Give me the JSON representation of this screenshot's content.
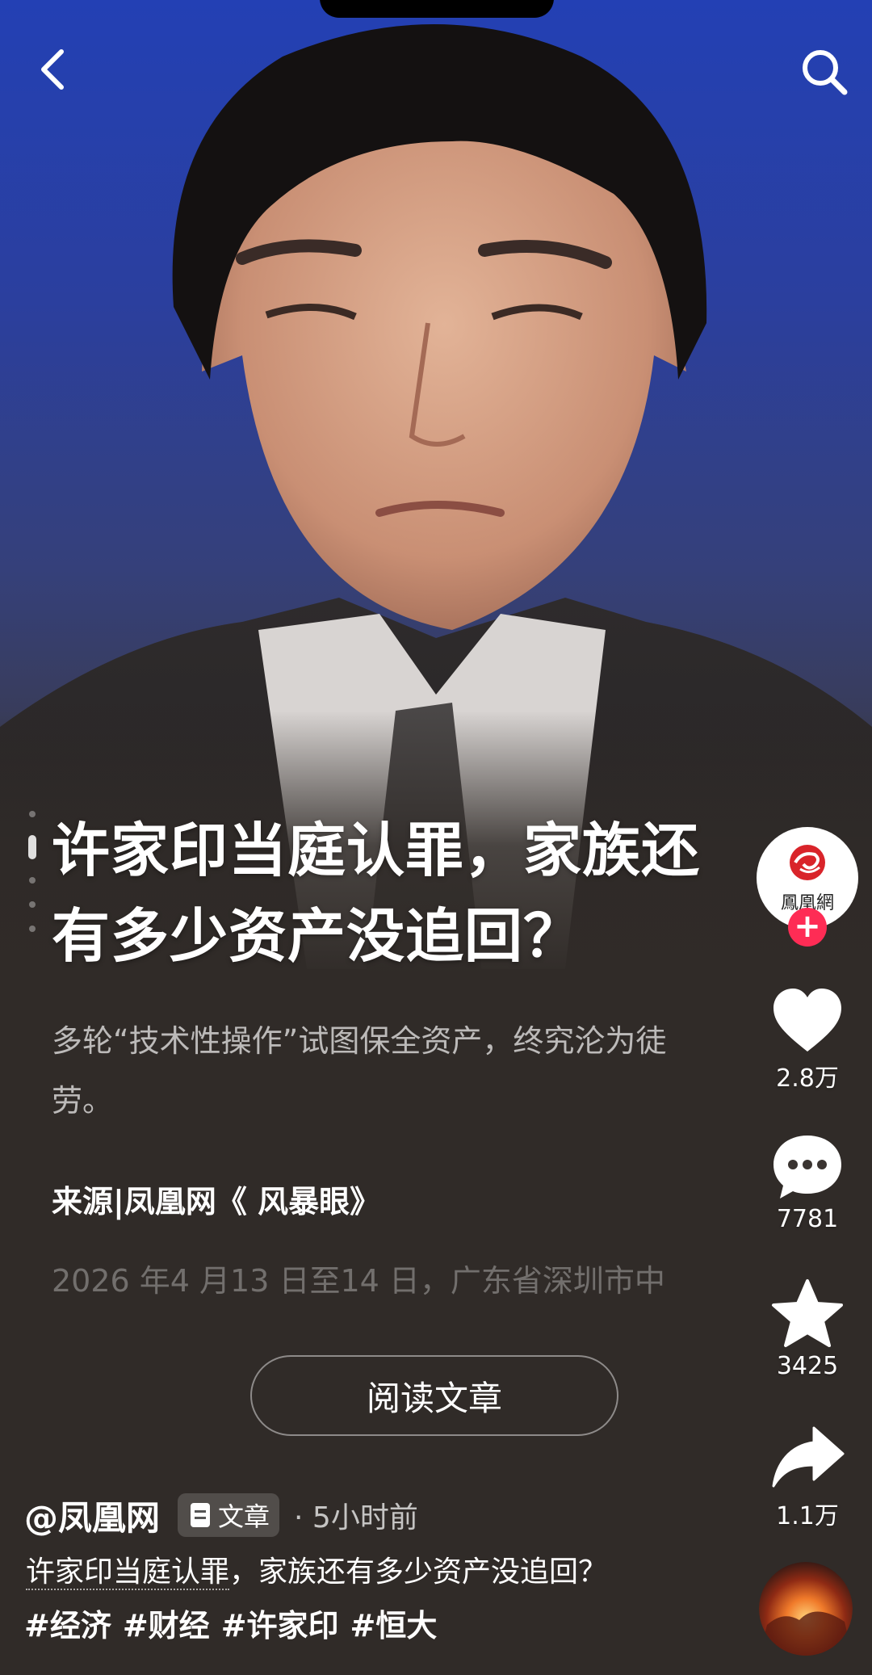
{
  "article": {
    "title": "许家印当庭认罪，家族还有多少资产没追回？",
    "subtitle": "多轮“技术性操作”试图保全资产，终究沦为徒劳。",
    "source": "来源|凤凰网《 风暴眼》",
    "excerpt": "2026 年4 月13 日至14 日，广东省深圳市中",
    "read_button": "阅读文章"
  },
  "rail": {
    "avatar_text": "鳳凰網",
    "follow_symbol": "+",
    "like_count": "2.8万",
    "comment_count": "7781",
    "favorite_count": "3425",
    "share_count": "1.1万"
  },
  "footer": {
    "author": "@凤凰网",
    "badge": "文章",
    "timestamp": "· 5小时前",
    "desc_mention": "许家印当庭认罪",
    "desc_rest": "，家族还有多少资产没追回？",
    "tags": [
      "#经济",
      "#财经",
      "#许家印",
      "#恒大"
    ]
  },
  "colors": {
    "accent": "#fe2c55",
    "background": "#302b28",
    "sky": "#2340b4"
  },
  "icons": [
    "back-icon",
    "search-icon",
    "heart-icon",
    "comment-icon",
    "star-icon",
    "share-icon",
    "plus-icon",
    "document-icon"
  ]
}
